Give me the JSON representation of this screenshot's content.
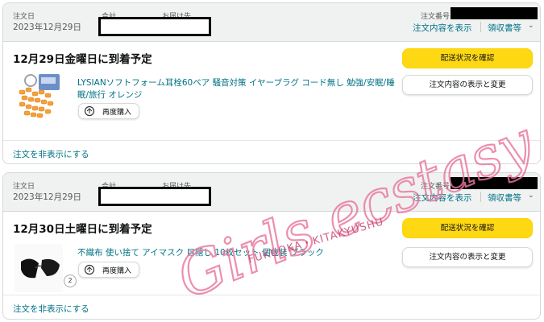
{
  "orders": [
    {
      "order_date_label": "注文日",
      "order_date": "2023年12月29日",
      "total_label": "合計",
      "ship_to_label": "お届け先",
      "order_number_label": "注文番号",
      "view_details_link": "注文内容を表示",
      "receipt_link": "領収書等",
      "delivery_status": "12月29日金曜日に到着予定",
      "track_button": "配送状況を確認",
      "modify_button": "注文内容の表示と変更",
      "product_title": "LYSIANソフトフォーム耳栓60ペア 騒音対策 イヤープラグ コード無し 勉強/安眠/睡眠/旅行 オレンジ",
      "rebuy_button": "再度購入",
      "hide_order_link": "注文を非表示にする"
    },
    {
      "order_date_label": "注文日",
      "order_date": "2023年12月29日",
      "total_label": "合計",
      "ship_to_label": "お届け先",
      "order_number_label": "注文番号",
      "view_details_link": "注文内容を表示",
      "receipt_link": "領収書等",
      "delivery_status": "12月30日土曜日に到着予定",
      "track_button": "配送状況を確認",
      "modify_button": "注文内容の表示と変更",
      "product_title": "不織布 使い捨て アイマスク 目隠し 10枚セット 個包装 ブラック",
      "quantity_badge": "2",
      "rebuy_button": "再度購入",
      "hide_order_link": "注文を非表示にする"
    }
  ],
  "watermark": {
    "title": "Girls ecstasy",
    "subtitle": "FUKUOKA・KITAKYUSHU"
  },
  "colors": {
    "link": "#007185",
    "primary_button": "#ffd814",
    "header_bg": "#f0f2f2",
    "watermark": "#e8779c"
  }
}
